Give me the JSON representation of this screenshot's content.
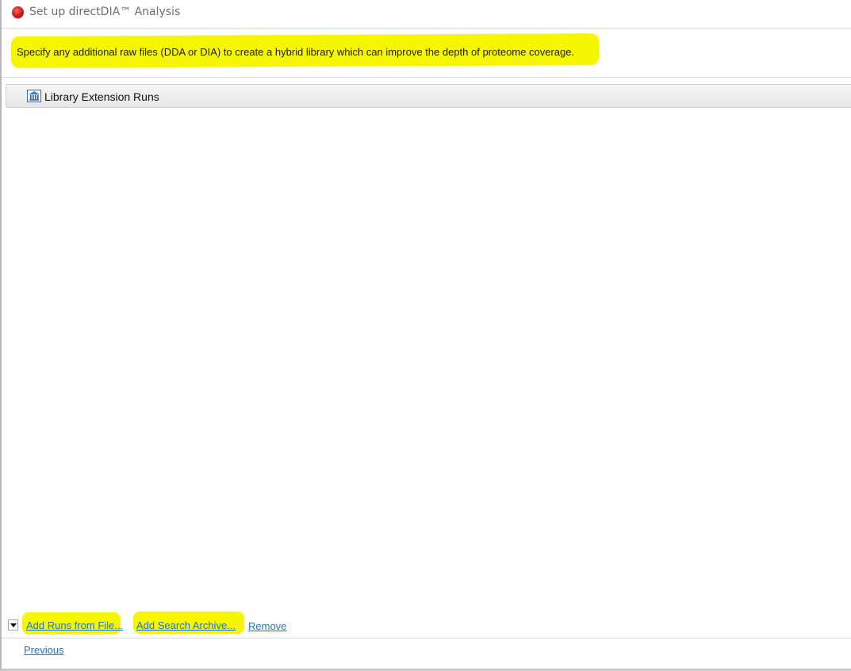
{
  "window": {
    "title": "Set up directDIA™ Analysis",
    "app_icon": "red-sphere-icon"
  },
  "description": {
    "text": "Specify any additional raw files (DDA or DIA) to create a hybrid library which can improve the depth of proteome coverage.",
    "highlight_color": "#f6f600"
  },
  "section": {
    "label": "Library Extension Runs",
    "icon": "library-icon"
  },
  "actions": {
    "add_runs_from_file": "Add Runs from File...",
    "add_search_archive": "Add Search Archive...",
    "remove": "Remove",
    "dropdown_icon": "chevron-down-icon"
  },
  "navigation": {
    "previous": "Previous"
  },
  "colors": {
    "link": "#1e73c8",
    "highlight": "#f6f600",
    "title_text": "#6d6d6d"
  }
}
